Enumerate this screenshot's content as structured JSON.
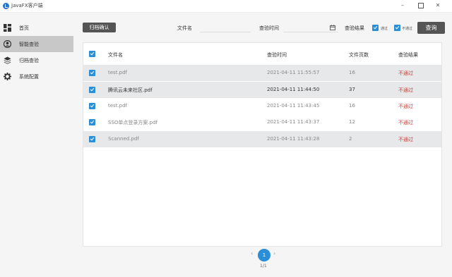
{
  "window": {
    "title": "JavaFX客户端"
  },
  "sidebar": {
    "items": [
      {
        "label": "首页",
        "icon": "dashboard-icon"
      },
      {
        "label": "智能查验",
        "icon": "user-circle-icon"
      },
      {
        "label": "归档查验",
        "icon": "layers-icon"
      },
      {
        "label": "系统配置",
        "icon": "gear-icon"
      }
    ]
  },
  "toolbar": {
    "archive_button": "归档确认",
    "filename_label": "文件名",
    "filename_value": "",
    "time_label": "查验时间",
    "time_value": "",
    "result_label": "查验结果",
    "pass_label": "通过",
    "fail_label": "不通过",
    "search_button": "查询"
  },
  "table": {
    "headers": [
      "文件名",
      "查验时间",
      "文件页数",
      "查验结果"
    ],
    "rows": [
      {
        "name": "test.pdf",
        "time": "2021-04-11 11:55:57",
        "pages": "16",
        "result": "不通过"
      },
      {
        "name": "腾讯云未来社区.pdf",
        "time": "2021-04-11 11:44:50",
        "pages": "37",
        "result": "不通过"
      },
      {
        "name": "test.pdf",
        "time": "2021-04-11 11:43:45",
        "pages": "16",
        "result": "不通过"
      },
      {
        "name": "SSO单点登录方案.pdf",
        "time": "2021-04-11 11:43:37",
        "pages": "12",
        "result": "不通过"
      },
      {
        "name": "Scanned.pdf",
        "time": "2021-04-11 11:43:28",
        "pages": "2",
        "result": "不通过"
      }
    ]
  },
  "pagination": {
    "current": "1",
    "info": "1/1",
    "prev": "‹",
    "next": "›"
  },
  "colors": {
    "accent": "#2b8fd8",
    "fail": "#e5342c",
    "active_nav": "#c8c8c8"
  }
}
